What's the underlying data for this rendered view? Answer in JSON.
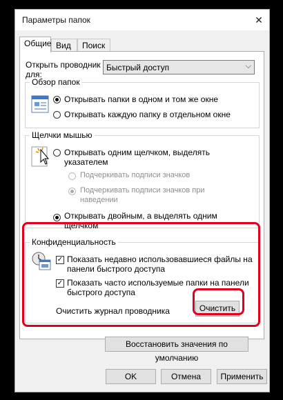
{
  "window": {
    "title": "Параметры папок",
    "close_glyph": "✕"
  },
  "tabs": [
    "Общие",
    "Вид",
    "Поиск"
  ],
  "open_explorer": {
    "label_line1": "Открыть проводник",
    "label_line2": "для:",
    "value": "Быстрый доступ"
  },
  "browse": {
    "legend": "Обзор папок",
    "option1": "Открывать папки в одном и том же окне",
    "option2": "Открывать каждую папку в отдельном окне"
  },
  "clicks": {
    "legend": "Щелчки мышью",
    "single_line1": "Открывать одним щелчком, выделять",
    "single_line2": "указателем",
    "underline_icons": "Подчеркивать подписи значков",
    "underline_hover_line1": "Подчеркивать подписи значков при",
    "underline_hover_line2": "наведении",
    "double_line1": "Открывать двойным, а выделять одним",
    "double_line2": "щелчком"
  },
  "privacy": {
    "legend": "Конфиденциальность",
    "recent_files_line1": "Показать недавно использовавшиеся файлы на",
    "recent_files_line2": "панели быстрого доступа",
    "frequent_folders_line1": "Показать часто используемые папки на панели",
    "frequent_folders_line2": "быстрого доступа",
    "clear_label": "Очистить журнал проводника",
    "clear_button": "Очистить"
  },
  "restore_button": "Восстановить значения по умолчанию",
  "buttons": {
    "ok": "OK",
    "cancel": "Отмена",
    "apply": "Применить"
  },
  "colors": {
    "highlight": "#e0001b",
    "accent": "#0078d7"
  }
}
